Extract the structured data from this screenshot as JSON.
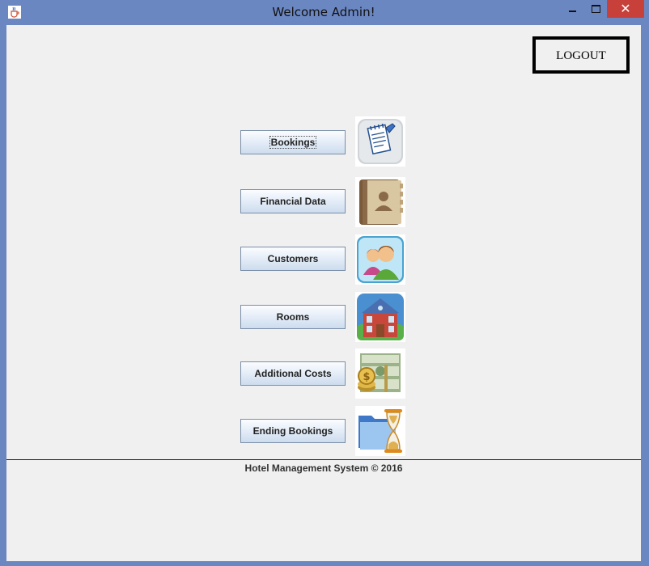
{
  "window": {
    "title": "Welcome Admin!",
    "app_icon": "java-cup-icon"
  },
  "header": {
    "logout_label": "LOGOUT"
  },
  "menu": {
    "items": [
      {
        "label": "Bookings",
        "icon": "notepad-icon"
      },
      {
        "label": "Financial Data",
        "icon": "address-book-icon"
      },
      {
        "label": "Customers",
        "icon": "users-icon"
      },
      {
        "label": "Rooms",
        "icon": "house-icon"
      },
      {
        "label": "Additional Costs",
        "icon": "money-icon"
      },
      {
        "label": "Ending Bookings",
        "icon": "folder-hourglass-icon"
      }
    ]
  },
  "footer": {
    "text": "Hotel Management System © 2016"
  },
  "colors": {
    "window_frame": "#6b87c2",
    "client_background": "#f0f0f0",
    "close_button": "#c7403a"
  }
}
